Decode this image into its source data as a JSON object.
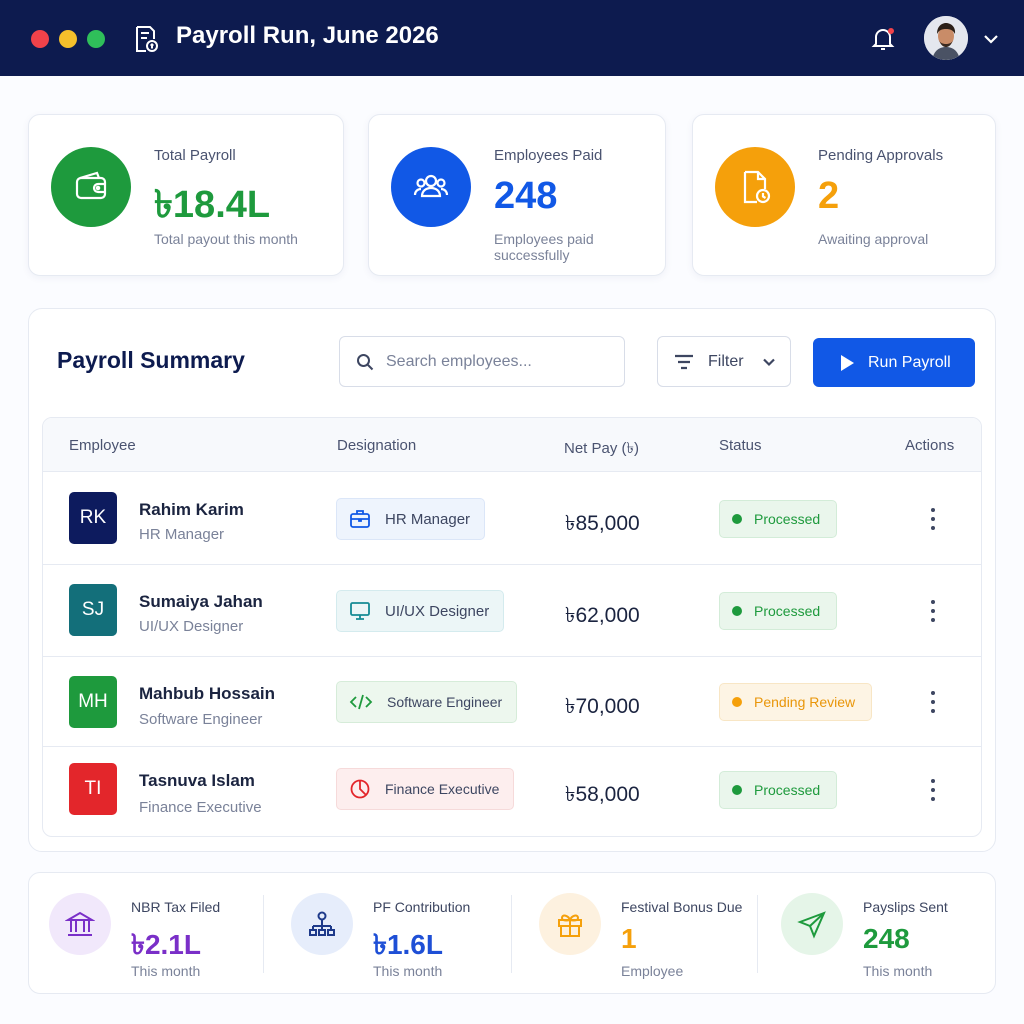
{
  "window": {
    "title": "Payroll Run, June 2026",
    "dots": [
      "#f0424a",
      "#f5c02b",
      "#2fbf5a"
    ]
  },
  "stats": [
    {
      "label": "Total Payroll",
      "value": "৳18.4L",
      "sub": "Total payout this month",
      "color": "#1e9a3d",
      "icon": "wallet-icon"
    },
    {
      "label": "Employees Paid",
      "value": "248",
      "sub": "Employees paid successfully",
      "color": "#1158e6",
      "icon": "users-icon"
    },
    {
      "label": "Pending Approvals",
      "value": "2",
      "sub": "Awaiting approval",
      "color": "#f5a00b",
      "icon": "document-clock-icon"
    }
  ],
  "summary": {
    "title": "Payroll Summary",
    "search_placeholder": "Search employees...",
    "filter_label": "Filter",
    "run_label": "Run Payroll",
    "columns": [
      "Employee",
      "Designation",
      "Net Pay (৳)",
      "Status",
      "Actions"
    ],
    "rows": [
      {
        "initials": "RK",
        "name": "Rahim Karim",
        "role": "HR Manager",
        "designation": "HR Manager",
        "designation_icon": "briefcase-icon",
        "net_pay": "৳85,000",
        "status": "Processed",
        "avatar_color": "#0d1b5e"
      },
      {
        "initials": "SJ",
        "name": "Sumaiya Jahan",
        "role": "UI/UX Designer",
        "designation": "UI/UX Designer",
        "designation_icon": "monitor-icon",
        "net_pay": "৳62,000",
        "status": "Processed",
        "avatar_color": "#136f7a"
      },
      {
        "initials": "MH",
        "name": "Mahbub Hossain",
        "role": "Software Engineer",
        "designation": "Software Engineer",
        "designation_icon": "code-icon",
        "net_pay": "৳70,000",
        "status": "Pending Review",
        "avatar_color": "#1e9a3d"
      },
      {
        "initials": "TI",
        "name": "Tasnuva Islam",
        "role": "Finance Executive",
        "designation": "Finance Executive",
        "designation_icon": "pie-chart-icon",
        "net_pay": "৳58,000",
        "status": "Processed",
        "avatar_color": "#e3262b"
      }
    ]
  },
  "bottom_stats": [
    {
      "label": "NBR Tax Filed",
      "value": "৳2.1L",
      "sub": "This month",
      "color": "#7a2fc8",
      "icon": "bank-icon"
    },
    {
      "label": "PF Contribution",
      "value": "৳1.6L",
      "sub": "This month",
      "color": "#1e4fd6",
      "icon": "org-chart-icon"
    },
    {
      "label": "Festival Bonus Due",
      "value": "1",
      "sub": "Employee",
      "color": "#f5a00b",
      "icon": "gift-icon"
    },
    {
      "label": "Payslips Sent",
      "value": "248",
      "sub": "This month",
      "color": "#1e9a3d",
      "icon": "send-icon"
    }
  ]
}
